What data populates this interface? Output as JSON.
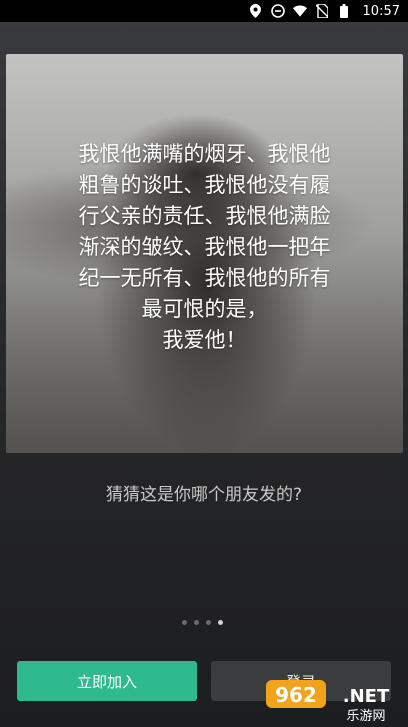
{
  "status_bar": {
    "time": "10:57",
    "icons": [
      "location-icon",
      "sync-icon",
      "wifi-icon",
      "no-sim-icon",
      "battery-icon"
    ]
  },
  "card": {
    "lines": [
      "我恨他满嘴的烟牙、我恨他",
      "粗鲁的谈吐、我恨他没有履",
      "行父亲的责任、我恨他满脸",
      "渐深的皱纹、我恨他一把年",
      "纪一无所有、我恨他的所有",
      "最可恨的是，",
      "我爱他！"
    ]
  },
  "caption": "猜猜这是你哪个朋友发的?",
  "pager": {
    "count": 4,
    "active_index": 3
  },
  "buttons": {
    "join_label": "立即加入",
    "login_label": "登录"
  },
  "watermark": {
    "brand": "962.NET",
    "sub": "乐游网"
  },
  "colors": {
    "primary": "#2fb98e",
    "background": "#1e1f21",
    "secondary_button": "#3b3c3e"
  }
}
